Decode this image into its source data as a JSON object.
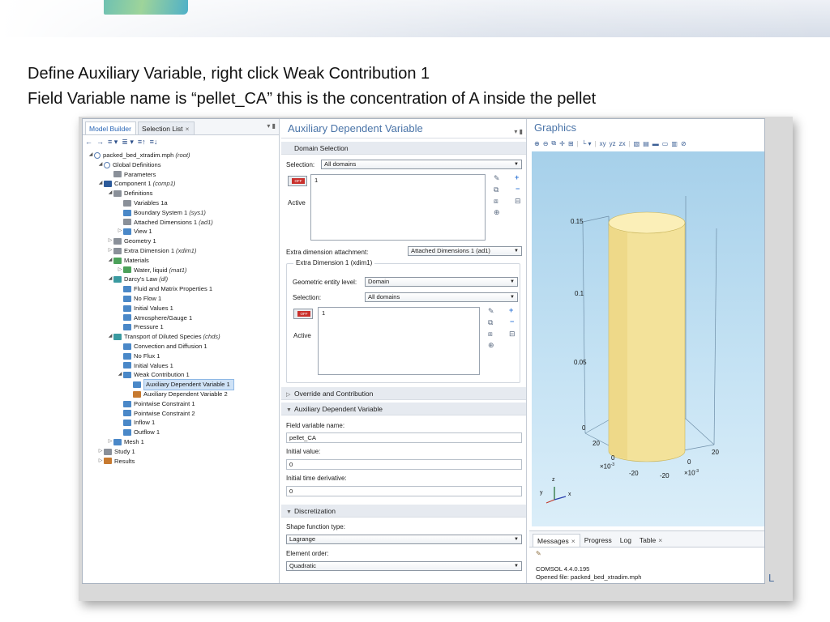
{
  "slide": {
    "line1": "Define Auxiliary Variable, right click Weak Contribution 1",
    "line2": "Field Variable name is “pellet_CA” this is the concentration of A inside the pellet",
    "brand_tail": "L"
  },
  "model_builder": {
    "tabs": [
      "Model Builder",
      "Selection List"
    ],
    "close_glyph": "×",
    "pane_controls": "▾ ▮",
    "toolbar_glyphs": [
      "←",
      "→",
      "≡ ▾",
      "≣ ▾",
      "≡↑",
      "≡↓"
    ],
    "tree": [
      {
        "label": "packed_bed_xtradim.mph",
        "extra": "(root)",
        "level": 0,
        "exp": "◢",
        "icon": "outline"
      },
      {
        "label": "Global Definitions",
        "extra": "",
        "level": 1,
        "exp": "◢",
        "icon": "outline"
      },
      {
        "label": "Parameters",
        "extra": "",
        "level": 2,
        "exp": "",
        "icon": "grey"
      },
      {
        "label": "Component 1",
        "extra": "(comp1)",
        "level": 1,
        "exp": "◢",
        "icon": "navy"
      },
      {
        "label": "Definitions",
        "extra": "",
        "level": 2,
        "exp": "◢",
        "icon": "grey"
      },
      {
        "label": "Variables 1a",
        "extra": "",
        "level": 3,
        "exp": "",
        "icon": "grey"
      },
      {
        "label": "Boundary System 1",
        "extra": "(sys1)",
        "level": 3,
        "exp": "",
        "icon": "blue"
      },
      {
        "label": "Attached Dimensions 1",
        "extra": "(ad1)",
        "level": 3,
        "exp": "",
        "icon": "grey"
      },
      {
        "label": "View 1",
        "extra": "",
        "level": 3,
        "exp": "▷",
        "icon": "blue"
      },
      {
        "label": "Geometry 1",
        "extra": "",
        "level": 2,
        "exp": "▷",
        "icon": "grey"
      },
      {
        "label": "Extra Dimension 1",
        "extra": "(xdim1)",
        "level": 2,
        "exp": "▷",
        "icon": "grey"
      },
      {
        "label": "Materials",
        "extra": "",
        "level": 2,
        "exp": "◢",
        "icon": "green"
      },
      {
        "label": "Water, liquid",
        "extra": "(mat1)",
        "level": 3,
        "exp": "▷",
        "icon": "green"
      },
      {
        "label": "Darcy's Law",
        "extra": "(dl)",
        "level": 2,
        "exp": "◢",
        "icon": "teal"
      },
      {
        "label": "Fluid and Matrix Properties 1",
        "extra": "",
        "level": 3,
        "exp": "",
        "icon": "blue"
      },
      {
        "label": "No Flow 1",
        "extra": "",
        "level": 3,
        "exp": "",
        "icon": "blue"
      },
      {
        "label": "Initial Values 1",
        "extra": "",
        "level": 3,
        "exp": "",
        "icon": "blue"
      },
      {
        "label": "Atmosphere/Gauge 1",
        "extra": "",
        "level": 3,
        "exp": "",
        "icon": "blue"
      },
      {
        "label": "Pressure 1",
        "extra": "",
        "level": 3,
        "exp": "",
        "icon": "blue"
      },
      {
        "label": "Transport of Diluted Species",
        "extra": "(chds)",
        "level": 2,
        "exp": "◢",
        "icon": "teal"
      },
      {
        "label": "Convection and Diffusion 1",
        "extra": "",
        "level": 3,
        "exp": "",
        "icon": "blue"
      },
      {
        "label": "No Flux 1",
        "extra": "",
        "level": 3,
        "exp": "",
        "icon": "blue"
      },
      {
        "label": "Initial Values 1",
        "extra": "",
        "level": 3,
        "exp": "",
        "icon": "blue"
      },
      {
        "label": "Weak Contribution 1",
        "extra": "",
        "level": 3,
        "exp": "◢",
        "icon": "blue"
      },
      {
        "label": "Auxiliary Dependent Variable 1",
        "extra": "",
        "level": 4,
        "exp": "",
        "icon": "blue",
        "selected": true
      },
      {
        "label": "Auxiliary Dependent Variable 2",
        "extra": "",
        "level": 4,
        "exp": "",
        "icon": "orange"
      },
      {
        "label": "Pointwise Constraint 1",
        "extra": "",
        "level": 3,
        "exp": "",
        "icon": "blue"
      },
      {
        "label": "Pointwise Constraint 2",
        "extra": "",
        "level": 3,
        "exp": "",
        "icon": "blue"
      },
      {
        "label": "Inflow 1",
        "extra": "",
        "level": 3,
        "exp": "",
        "icon": "blue"
      },
      {
        "label": "Outflow 1",
        "extra": "",
        "level": 3,
        "exp": "",
        "icon": "blue"
      },
      {
        "label": "Mesh 1",
        "extra": "",
        "level": 2,
        "exp": "▷",
        "icon": "blue"
      },
      {
        "label": "Study 1",
        "extra": "",
        "level": 1,
        "exp": "▷",
        "icon": "grey"
      },
      {
        "label": "Results",
        "extra": "",
        "level": 1,
        "exp": "▷",
        "icon": "orange"
      }
    ]
  },
  "settings": {
    "title": "Auxiliary Dependent Variable",
    "pane_controls": "▾ ▮",
    "domain_selection_header": "Domain Selection",
    "selection_label": "Selection:",
    "selection_value": "All domains",
    "selection_list": [
      "1"
    ],
    "active_label": "Active",
    "off_text": "OFF",
    "extra_dim_label": "Extra dimension attachment:",
    "extra_dim_value": "Attached Dimensions 1 (ad1)",
    "group_title": "Extra Dimension 1 (xdim1)",
    "geo_level_label": "Geometric entity level:",
    "geo_level_value": "Domain",
    "group_selection_label": "Selection:",
    "group_selection_value": "All domains",
    "group_list": [
      "1"
    ],
    "group_active_label": "Active",
    "override_header": "Override and Contribution",
    "aux_header": "Auxiliary Dependent Variable",
    "field_var_label": "Field variable name:",
    "field_var_value": "pellet_CA",
    "initial_value_label": "Initial value:",
    "initial_value": "0",
    "initial_deriv_label": "Initial time derivative:",
    "initial_deriv": "0",
    "discretization_header": "Discretization",
    "shape_fn_label": "Shape function type:",
    "shape_fn_value": "Lagrange",
    "element_order_label": "Element order:",
    "element_order_value": "Quadratic",
    "dropdown_glyph": "▼",
    "collapsed_glyph": "▷",
    "expanded_glyph": "▼",
    "list_tool_glyphs": {
      "pick": "✎",
      "copy": "⧉",
      "paste": "⧈",
      "zoom": "⊕",
      "add": "+",
      "remove": "−",
      "clear": "⊟"
    }
  },
  "graphics": {
    "title": "Graphics",
    "toolbar_glyphs": [
      "⊕",
      "⊖",
      "⧉",
      "✛",
      "⊞",
      "|",
      "└ ▾",
      "|",
      "xy",
      "yz",
      "zx",
      "|",
      "▧",
      "▤",
      "▬",
      "▭",
      "▥",
      "⊘"
    ],
    "axis_labels": {
      "z015": "0.15",
      "z01": "0.1",
      "z005": "0.05",
      "z0": "0",
      "left20": "20",
      "x0": "0",
      "xe": "×10",
      "xe_exp": "-3",
      "xneg20": "-20",
      "y20": "20",
      "y0": "0",
      "yneg20": "-20",
      "ye": "×10",
      "ye_exp": "-3"
    },
    "triad": {
      "z": "z",
      "y": "y",
      "x": "x"
    },
    "colors": {
      "background_top": "#a6d0ea",
      "cylinder": "#f3e29a",
      "cylinder_top": "#fbefb8"
    }
  },
  "messages": {
    "tabs": [
      {
        "label": "Messages",
        "closable": true
      },
      {
        "label": "Progress",
        "closable": false
      },
      {
        "label": "Log",
        "closable": false
      },
      {
        "label": "Table",
        "closable": true
      }
    ],
    "close_glyph": "×",
    "clear_glyph": "✎",
    "lines": [
      "COMSOL 4.4.0.195",
      "Opened file: packed_bed_xtradim.mph"
    ]
  }
}
